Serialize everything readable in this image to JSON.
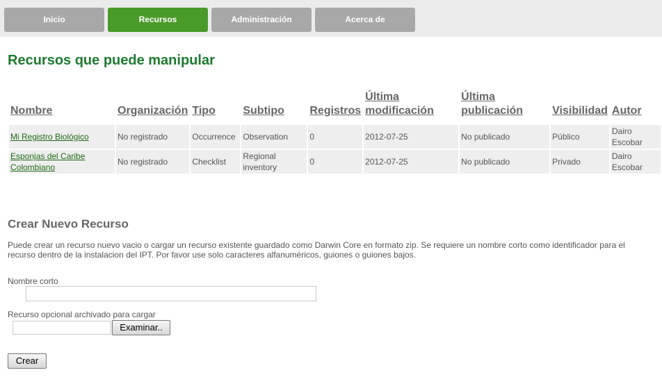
{
  "nav": {
    "tabs": [
      {
        "label": "Inicio",
        "active": false
      },
      {
        "label": "Recursos",
        "active": true
      },
      {
        "label": "Administración",
        "active": false
      },
      {
        "label": "Acerca de",
        "active": false
      }
    ]
  },
  "resources": {
    "title": "Recursos que puede manipular",
    "columns": [
      "Nombre",
      "Organización",
      "Tipo",
      "Subtipo",
      "Registros",
      "Última modificación",
      "Última publicación",
      "Visibilidad",
      "Autor"
    ],
    "rows": [
      {
        "name": "Mi Registro Biológico",
        "org": "No registrado",
        "type": "Occurrence",
        "subtype": "Observation",
        "records": "0",
        "modified": "2012-07-25",
        "published": "No publicado",
        "visibility": "Público",
        "author": "Dairo Escobar"
      },
      {
        "name": "Esponjas del Caribe Colombiano",
        "org": "No registrado",
        "type": "Checklist",
        "subtype": "Regional inventory",
        "records": "0",
        "modified": "2012-07-25",
        "published": "No publicado",
        "visibility": "Privado",
        "author": "Dairo Escobar"
      }
    ]
  },
  "create": {
    "title": "Crear Nuevo Recurso",
    "description": "Puede crear un recurso nuevo vacio o cargar un recurso existente guardado como Darwin Core en formato zip. Se requiere un nombre corto como identificador para el recurso dentro de la instalacion del IPT. Por favor use solo caracteres alfanuméricos, guiones o guiones bajos.",
    "short_name_label": "Nombre corto",
    "short_name_value": "",
    "file_label": "Recurso opcional archivado para cargar",
    "file_value": "",
    "browse_label": "Examinar..",
    "submit_label": "Crear"
  },
  "colors": {
    "nav_bg": "#ebebeb",
    "tab": "#a8a8a8",
    "tab_active": "#4a9a2a",
    "title": "#1e7a2e",
    "link": "#1e6b14"
  }
}
